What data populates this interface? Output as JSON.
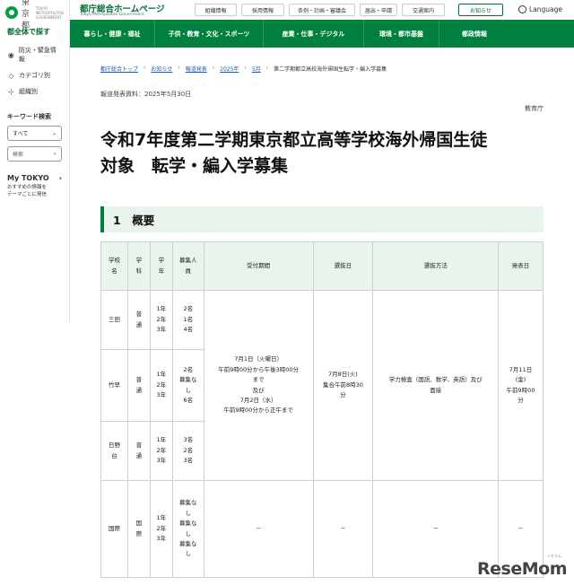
{
  "sidebar": {
    "logo_text": "東京都",
    "logo_sub": "TOKYO METROPOLITAN GOVERNMENT",
    "heading": "都全体で探す",
    "items": [
      {
        "label": "防災・緊急情報",
        "icon": "radio-icon"
      },
      {
        "label": "カテゴリ別",
        "icon": "tag-icon"
      },
      {
        "label": "組織別",
        "icon": "org-chart-icon"
      }
    ],
    "keyword_label": "キーワード検索",
    "select_value": "すべて",
    "search_placeholder": "検索",
    "mytokyo_title": "My TOKYO",
    "mytokyo_sub1": "おすすめの情報を",
    "mytokyo_sub2": "テーマごとに発信"
  },
  "header": {
    "site_title": "都庁総合ホームページ",
    "site_title_en": "Tokyo Metropolitan Government",
    "top_links": [
      "組織情報",
      "採用情報",
      "条例・計画・審議会",
      "届出・申請",
      "交通案内"
    ],
    "notice_button": "お知らせ",
    "language": "Language"
  },
  "nav": {
    "items": [
      "暮らし・健康・福祉",
      "子供・教育・文化・スポーツ",
      "産業・仕事・デジタル",
      "環境・都市基盤",
      "都政情報"
    ]
  },
  "breadcrumb": {
    "links": [
      "都庁総合トップ",
      "お知らせ",
      "報道発表",
      "2025年",
      "5月"
    ],
    "current": "第二学期都立高校海外帰国生転学・編入学募集"
  },
  "article": {
    "date_line": "報道発表資料：2025年5月30日",
    "department": "教育庁",
    "title_line1": "令和7年度第二学期東京都立高等学校海外帰国生徒",
    "title_line2": "対象　転学・編入学募集",
    "section_heading": "1　概要"
  },
  "table": {
    "headers": {
      "school": [
        "学校",
        "名"
      ],
      "course": [
        "学",
        "科"
      ],
      "grade": [
        "学",
        "年"
      ],
      "capacity": [
        "募集人",
        "員"
      ],
      "reception": "受付期間",
      "exam_date": "選抜日",
      "method": "選抜方法",
      "announce": "発表日"
    },
    "rows": [
      {
        "school": [
          "三田"
        ],
        "course": [
          "普",
          "通"
        ],
        "grades": [
          "1年",
          "2年",
          "3年"
        ],
        "capacity": [
          "2名",
          "1名",
          "4名"
        ]
      },
      {
        "school": [
          "竹早"
        ],
        "course": [
          "普",
          "通"
        ],
        "grades": [
          "1年",
          "2年",
          "3年"
        ],
        "capacity": [
          "2名",
          "募集な",
          "し",
          "6名"
        ]
      },
      {
        "school": [
          "日野",
          "台"
        ],
        "course": [
          "普",
          "通"
        ],
        "grades": [
          "1年",
          "2年",
          "3年"
        ],
        "capacity": [
          "3名",
          "2名",
          "3名"
        ]
      },
      {
        "school": [
          "国際"
        ],
        "course": [
          "国",
          "際"
        ],
        "grades": [
          "1年",
          "2年",
          "3年"
        ],
        "capacity": [
          "募集な",
          "し",
          "募集な",
          "し",
          "募集な",
          "し"
        ]
      }
    ],
    "shared": {
      "reception": [
        "7月1日（火曜日）",
        "午前9時00分から午後3時00分",
        "まで",
        "及び",
        "7月2日（水）",
        "午前9時00分から正午まで"
      ],
      "exam_date": [
        "7月8日(火)",
        "集合午前8時30",
        "分"
      ],
      "method": [
        "学力検査（国語、数学、英語）及び",
        "面接"
      ],
      "announce": [
        "7月11日",
        "(金)",
        "午前9時00",
        "分"
      ]
    },
    "kokusai": {
      "reception": "－",
      "exam_date": "－",
      "method": "－",
      "announce": "－"
    }
  },
  "watermark": {
    "text": "ReseMom",
    "sub": "リセマム"
  }
}
